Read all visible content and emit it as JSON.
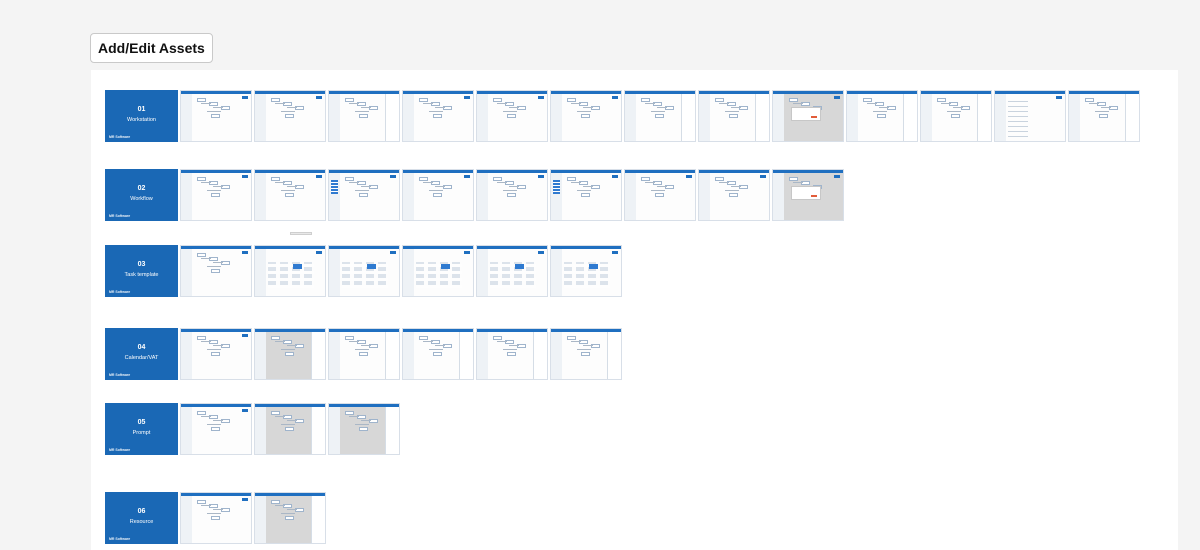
{
  "header": {
    "title": "Add/Edit Assets"
  },
  "brand_label": "MR Software",
  "colors": {
    "accent": "#1a68b5",
    "page_bg": "#f4f4f4",
    "board_bg": "#ffffff"
  },
  "sections": [
    {
      "number": "01",
      "name": "Workstation",
      "screens": [
        "base",
        "base",
        "panel",
        "base",
        "base",
        "base",
        "panel",
        "panel",
        "modal",
        "panel",
        "panel",
        "list",
        "panel"
      ]
    },
    {
      "number": "02",
      "name": "Workflow",
      "screens": [
        "base",
        "base",
        "highlight",
        "base",
        "base",
        "highlight",
        "base",
        "base",
        "modal"
      ]
    },
    {
      "number": "03",
      "name": "Task template",
      "screens": [
        "base",
        "grid",
        "grid",
        "grid",
        "grid",
        "grid"
      ]
    },
    {
      "number": "04",
      "name": "Calendar/VAT",
      "screens": [
        "base",
        "dim-panel",
        "panel",
        "panel",
        "panel",
        "panel"
      ]
    },
    {
      "number": "05",
      "name": "Prompt",
      "screens": [
        "base",
        "dim-panel",
        "dim-panel"
      ]
    },
    {
      "number": "06",
      "name": "Resource",
      "screens": [
        "base",
        "dim-panel"
      ]
    }
  ]
}
